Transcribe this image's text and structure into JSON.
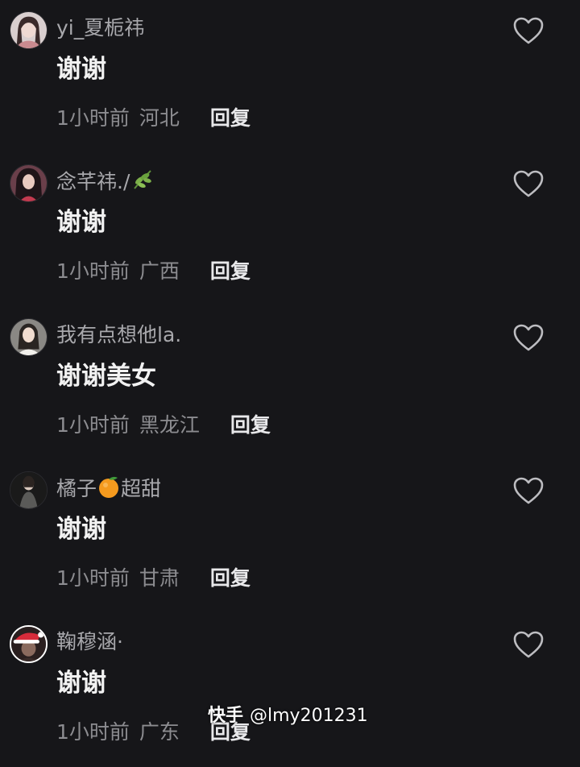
{
  "comments": [
    {
      "username": "yi_夏栀祎",
      "text": "谢谢",
      "time": "1小时前",
      "location": "河北",
      "reply_label": "回复",
      "avatar": "avatar-girl-1"
    },
    {
      "username": "念芊祎./",
      "username_emoji": "herb-emoji",
      "text": "谢谢",
      "time": "1小时前",
      "location": "广西",
      "reply_label": "回复",
      "avatar": "avatar-girl-2"
    },
    {
      "username": "我有点想他la.",
      "text": "谢谢美女",
      "time": "1小时前",
      "location": "黑龙江",
      "reply_label": "回复",
      "avatar": "avatar-girl-3"
    },
    {
      "username": "橘子",
      "username_emoji": "tangerine-emoji",
      "username_suffix": "超甜",
      "text": "谢谢",
      "time": "1小时前",
      "location": "甘肃",
      "reply_label": "回复",
      "avatar": "avatar-girl-4"
    },
    {
      "username": "鞠穆涵·",
      "text": "谢谢",
      "time": "1小时前",
      "location": "广东",
      "reply_label": "回复",
      "avatar": "avatar-santa-hat"
    }
  ],
  "like_icon": "heart-outline-icon",
  "watermark": {
    "brand": "快手",
    "handle": "@lmy201231"
  },
  "colors": {
    "background": "#161619",
    "username": "#a8a8ac",
    "text": "#f2f2f2",
    "meta": "#8c8c90"
  }
}
